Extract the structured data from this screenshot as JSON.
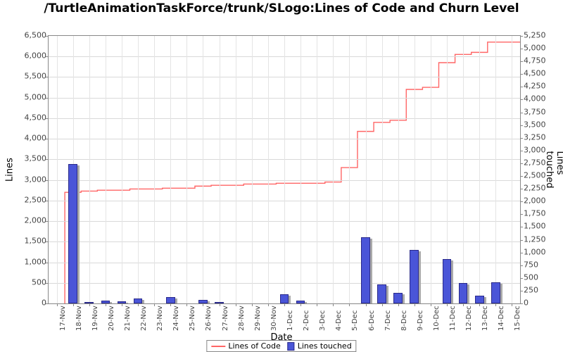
{
  "chart_data": {
    "type": "bar",
    "title": "/TurtleAnimationTaskForce/trunk/SLogo:Lines of Code and Churn Level",
    "xlabel": "Date",
    "y1label": "Lines",
    "y2label": "Lines touched",
    "categories": [
      "17-Nov",
      "18-Nov",
      "19-Nov",
      "20-Nov",
      "21-Nov",
      "22-Nov",
      "23-Nov",
      "24-Nov",
      "25-Nov",
      "26-Nov",
      "27-Nov",
      "28-Nov",
      "29-Nov",
      "30-Nov",
      "1-Dec",
      "2-Dec",
      "3-Dec",
      "4-Dec",
      "5-Dec",
      "6-Dec",
      "7-Dec",
      "8-Dec",
      "9-Dec",
      "10-Dec",
      "11-Dec",
      "12-Dec",
      "13-Dec",
      "14-Dec",
      "15-Dec"
    ],
    "series": [
      {
        "name": "Lines of Code",
        "axis": "y1",
        "style": "line",
        "color": "#ff6666",
        "values": [
          null,
          2700,
          2730,
          2750,
          2750,
          2780,
          2780,
          2800,
          2800,
          2850,
          2870,
          2870,
          2900,
          2900,
          2920,
          2920,
          2920,
          2950,
          3300,
          4180,
          4400,
          4450,
          5200,
          5250,
          5850,
          6050,
          6100,
          6350,
          6350
        ]
      },
      {
        "name": "Lines touched",
        "axis": "y2",
        "style": "bar",
        "color": "#4a55d8",
        "values": [
          0,
          2730,
          10,
          55,
          45,
          100,
          0,
          120,
          0,
          70,
          20,
          0,
          0,
          0,
          180,
          60,
          0,
          0,
          0,
          1300,
          380,
          210,
          1050,
          0,
          870,
          400,
          150,
          420,
          0
        ]
      }
    ],
    "y1": {
      "min": 0,
      "max": 6500,
      "step": 500,
      "ticks": [
        0,
        500,
        1000,
        1500,
        2000,
        2500,
        3000,
        3500,
        4000,
        4500,
        5000,
        5500,
        6000,
        6500
      ]
    },
    "y2": {
      "min": 0,
      "max": 5250,
      "step": 250,
      "ticks": [
        0,
        250,
        500,
        750,
        1000,
        1250,
        1500,
        1750,
        2000,
        2250,
        2500,
        2750,
        3000,
        3250,
        3500,
        3750,
        4000,
        4250,
        4500,
        4750,
        5000,
        5250
      ]
    },
    "legend": [
      "Lines of Code",
      "Lines touched"
    ]
  }
}
